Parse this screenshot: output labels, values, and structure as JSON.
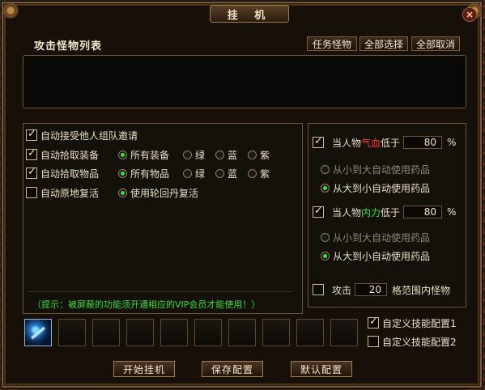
{
  "window": {
    "title": "挂 机",
    "close_label": "×"
  },
  "monster_list": {
    "title": "攻击怪物列表",
    "buttons": {
      "task": "任务怪物",
      "select_all": "全部选择",
      "cancel_all": "全部取消"
    }
  },
  "left_panel": {
    "rows": [
      {
        "label": "自动接受他人组队邀请",
        "checked": true
      },
      {
        "label": "自动拾取装备",
        "checked": true,
        "options": [
          {
            "label": "所有装备",
            "on": true
          },
          {
            "label": "绿",
            "on": false
          },
          {
            "label": "蓝",
            "on": false
          },
          {
            "label": "紫",
            "on": false
          }
        ]
      },
      {
        "label": "自动拾取物品",
        "checked": true,
        "options": [
          {
            "label": "所有物品",
            "on": true
          },
          {
            "label": "绿",
            "on": false
          },
          {
            "label": "蓝",
            "on": false
          },
          {
            "label": "紫",
            "on": false
          }
        ]
      },
      {
        "label": "自动原地复活",
        "checked": false,
        "options": [
          {
            "label": "使用轮回丹复活",
            "on": true
          }
        ]
      }
    ],
    "tip": "（提示：被屏蔽的功能须开通相应的VIP会员才能使用！）"
  },
  "right_panel": {
    "hp": {
      "prefix": "当人物",
      "stat": "气血",
      "suffix": "低于",
      "value": "80",
      "unit": "%",
      "checked": true,
      "opt_small_to_large": "从小到大自动使用药品",
      "opt_large_to_small": "从大到小自动使用药品"
    },
    "mp": {
      "prefix": "当人物",
      "stat": "内力",
      "suffix": "低于",
      "value": "80",
      "unit": "%",
      "checked": true,
      "opt_small_to_large": "从小到大自动使用药品",
      "opt_large_to_small": "从大到小自动使用药品"
    },
    "range": {
      "prefix": "攻击",
      "value": "20",
      "suffix": "格范围内怪物",
      "checked": false
    }
  },
  "skills": {
    "config1": {
      "label": "自定义技能配置1",
      "checked": true
    },
    "config2": {
      "label": "自定义技能配置2",
      "checked": false
    }
  },
  "bottom_buttons": {
    "start": "开始挂机",
    "save": "保存配置",
    "default": "默认配置"
  },
  "colors": {
    "hp_text": "#ff3a2a",
    "mp_text": "#40e040",
    "tip_text": "#3fdc3f"
  }
}
